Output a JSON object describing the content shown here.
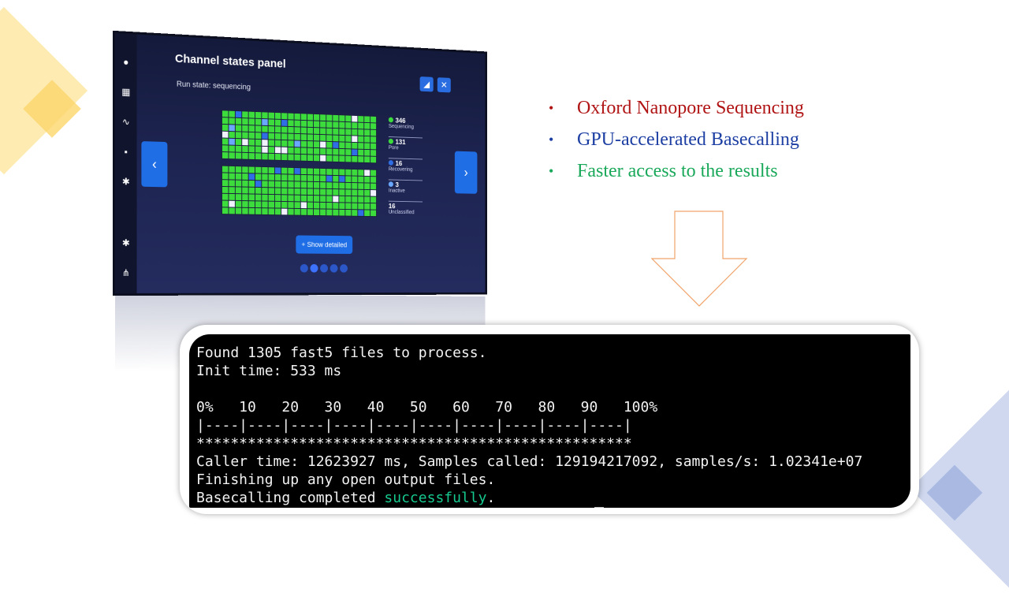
{
  "slide": {
    "bullets": [
      {
        "text": "Oxford Nanopore Sequencing",
        "color": "#b01414"
      },
      {
        "text": "GPU-accelerated Basecalling",
        "color": "#1d3fa3"
      },
      {
        "text": "Faster access to the results",
        "color": "#1aa85a"
      }
    ],
    "bullet_glyph": "•"
  },
  "device": {
    "panel_title": "Channel states panel",
    "run_state": "Run state: sequencing",
    "show_button": "+ Show detailed",
    "legend": [
      {
        "value": "346",
        "label": "Sequencing",
        "color": "#3ddc3d"
      },
      {
        "value": "131",
        "label": "Pore",
        "color": "#3ddc3d"
      },
      {
        "value": "16",
        "label": "Recovering",
        "color": "#2f6ee4"
      },
      {
        "value": "3",
        "label": "Inactive",
        "color": "#6aa8ff"
      },
      {
        "value": "16",
        "label": "Unclassified",
        "color": ""
      }
    ],
    "icons": [
      "record-icon",
      "grid-icon",
      "activity-icon",
      "chat-icon",
      "gear-icon",
      "settings-icon",
      "network-icon"
    ]
  },
  "terminal": {
    "lines": [
      "Found 1305 fast5 files to process.",
      "Init time: 533 ms",
      "",
      "0%   10   20   30   40   50   60   70   80   90   100%",
      "|----|----|----|----|----|----|----|----|----|----|",
      "***************************************************",
      "Caller time: 12623927 ms, Samples called: 129194217092, samples/s: 1.02341e+07",
      "Finishing up any open output files."
    ],
    "last_prefix": "Basecalling completed ",
    "last_status": "successfully",
    "last_suffix": "."
  }
}
